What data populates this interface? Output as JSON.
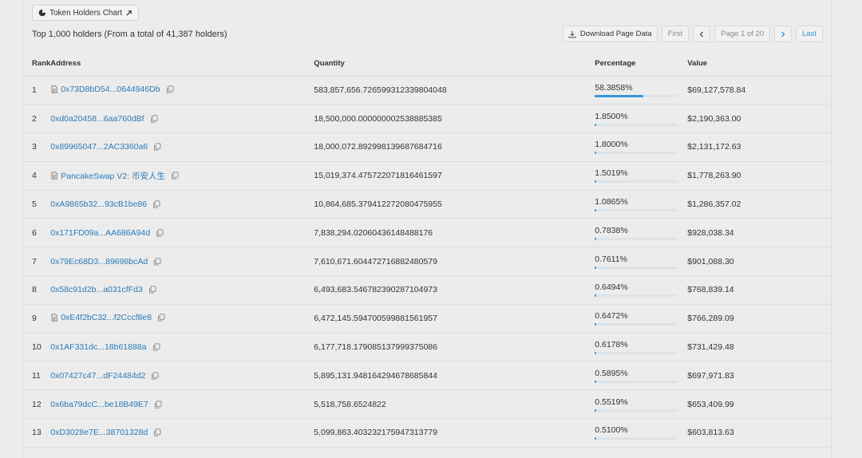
{
  "chart_button": {
    "label": "Token Holders Chart",
    "icon": "pie-chart-icon",
    "ext_icon": "external-link-icon"
  },
  "summary": "Top 1,000 holders (From a total of 41,387 holders)",
  "pager": {
    "download_label": "Download Page Data",
    "first_label": "First",
    "page_label": "Page 1 of 20",
    "last_label": "Last"
  },
  "table": {
    "headers": {
      "rank": "Rank",
      "address": "Address",
      "quantity": "Quantity",
      "percentage": "Percentage",
      "value": "Value"
    },
    "rows": [
      {
        "rank": "1",
        "address": "0x73D8bD54...0644946Db",
        "contract": true,
        "quantity": "583,857,656.726599312339804048",
        "percentage": "58.3858%",
        "pct": 58.3858,
        "value": "$69,127,578.84"
      },
      {
        "rank": "2",
        "address": "0xd0a20458...6aa760dBf",
        "contract": false,
        "quantity": "18,500,000.000000002538885385",
        "percentage": "1.8500%",
        "pct": 1.85,
        "value": "$2,190,363.00"
      },
      {
        "rank": "3",
        "address": "0x89965047...2AC3360a6",
        "contract": false,
        "quantity": "18,000,072.892998139687684716",
        "percentage": "1.8000%",
        "pct": 1.8,
        "value": "$2,131,172.63"
      },
      {
        "rank": "4",
        "address": "PancakeSwap V2: 币安人生",
        "contract": true,
        "quantity": "15,019,374.475722071816461597",
        "percentage": "1.5019%",
        "pct": 1.5019,
        "value": "$1,778,263.90"
      },
      {
        "rank": "5",
        "address": "0xA9865b32...93cB1be86",
        "contract": false,
        "quantity": "10,864,685.379412272080475955",
        "percentage": "1.0865%",
        "pct": 1.0865,
        "value": "$1,286,357.02"
      },
      {
        "rank": "6",
        "address": "0x171FD09a...AA686A94d",
        "contract": false,
        "quantity": "7,838,294.02060436148488176",
        "percentage": "0.7838%",
        "pct": 0.7838,
        "value": "$928,038.34"
      },
      {
        "rank": "7",
        "address": "0x79Ec68D3...89698bcAd",
        "contract": false,
        "quantity": "7,610,671.604472716882480579",
        "percentage": "0.7611%",
        "pct": 0.7611,
        "value": "$901,088.30"
      },
      {
        "rank": "8",
        "address": "0x58c91d2b...a031cfFd3",
        "contract": false,
        "quantity": "6,493,683.546782390287104973",
        "percentage": "0.6494%",
        "pct": 0.6494,
        "value": "$768,839.14"
      },
      {
        "rank": "9",
        "address": "0xE4f2bC32...f2Cccf8e8",
        "contract": true,
        "quantity": "6,472,145.594700599881561957",
        "percentage": "0.6472%",
        "pct": 0.6472,
        "value": "$766,289.09"
      },
      {
        "rank": "10",
        "address": "0x1AF331dc...18b61888a",
        "contract": false,
        "quantity": "6,177,718.179085137999375086",
        "percentage": "0.6178%",
        "pct": 0.6178,
        "value": "$731,429.48"
      },
      {
        "rank": "11",
        "address": "0x07427c47...dF24484d2",
        "contract": false,
        "quantity": "5,895,131.948164294678685844",
        "percentage": "0.5895%",
        "pct": 0.5895,
        "value": "$697,971.83"
      },
      {
        "rank": "12",
        "address": "0x6ba79dcC...be18B49E7",
        "contract": false,
        "quantity": "5,518,758.6524822",
        "percentage": "0.5519%",
        "pct": 0.5519,
        "value": "$653,409.99"
      },
      {
        "rank": "13",
        "address": "0xD3028e7E...38701328d",
        "contract": false,
        "quantity": "5,099,863.403232175947313779",
        "percentage": "0.5100%",
        "pct": 0.51,
        "value": "$603,813.63"
      }
    ]
  },
  "colors": {
    "link": "#2a7ab8",
    "accent": "#3498db"
  }
}
